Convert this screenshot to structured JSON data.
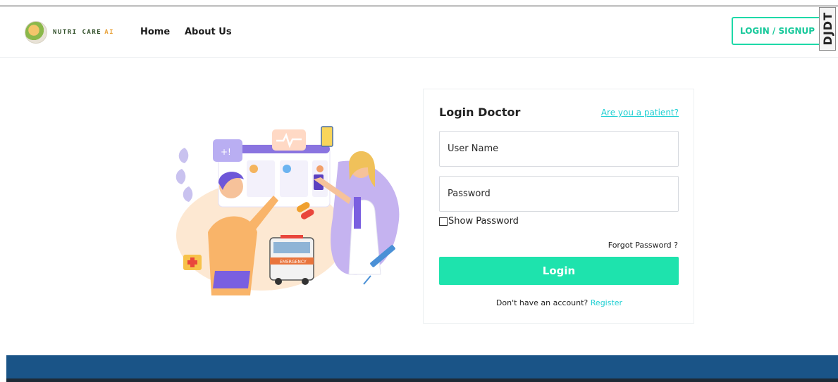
{
  "brand": {
    "name": "NUTRI CARE",
    "suffix": "AI"
  },
  "nav": {
    "home": "Home",
    "about": "About Us",
    "login_signup": "LOGIN / SIGNUP"
  },
  "corner_badge": "DJDT",
  "login": {
    "title": "Login Doctor",
    "patient_link": "Are you a patient?",
    "username_placeholder": "User Name",
    "password_placeholder": "Password",
    "show_password": "Show Password",
    "forgot": "Forgot Password ?",
    "button": "Login",
    "register_prompt": "Don't have an account?",
    "register_link": "Register"
  },
  "illustration": {
    "monitor_badge": "+!",
    "ambulance_label": "EMERGENCY"
  },
  "colors": {
    "accent": "#1ee3ad",
    "link": "#1ecfd2",
    "footer": "#1a5487"
  }
}
